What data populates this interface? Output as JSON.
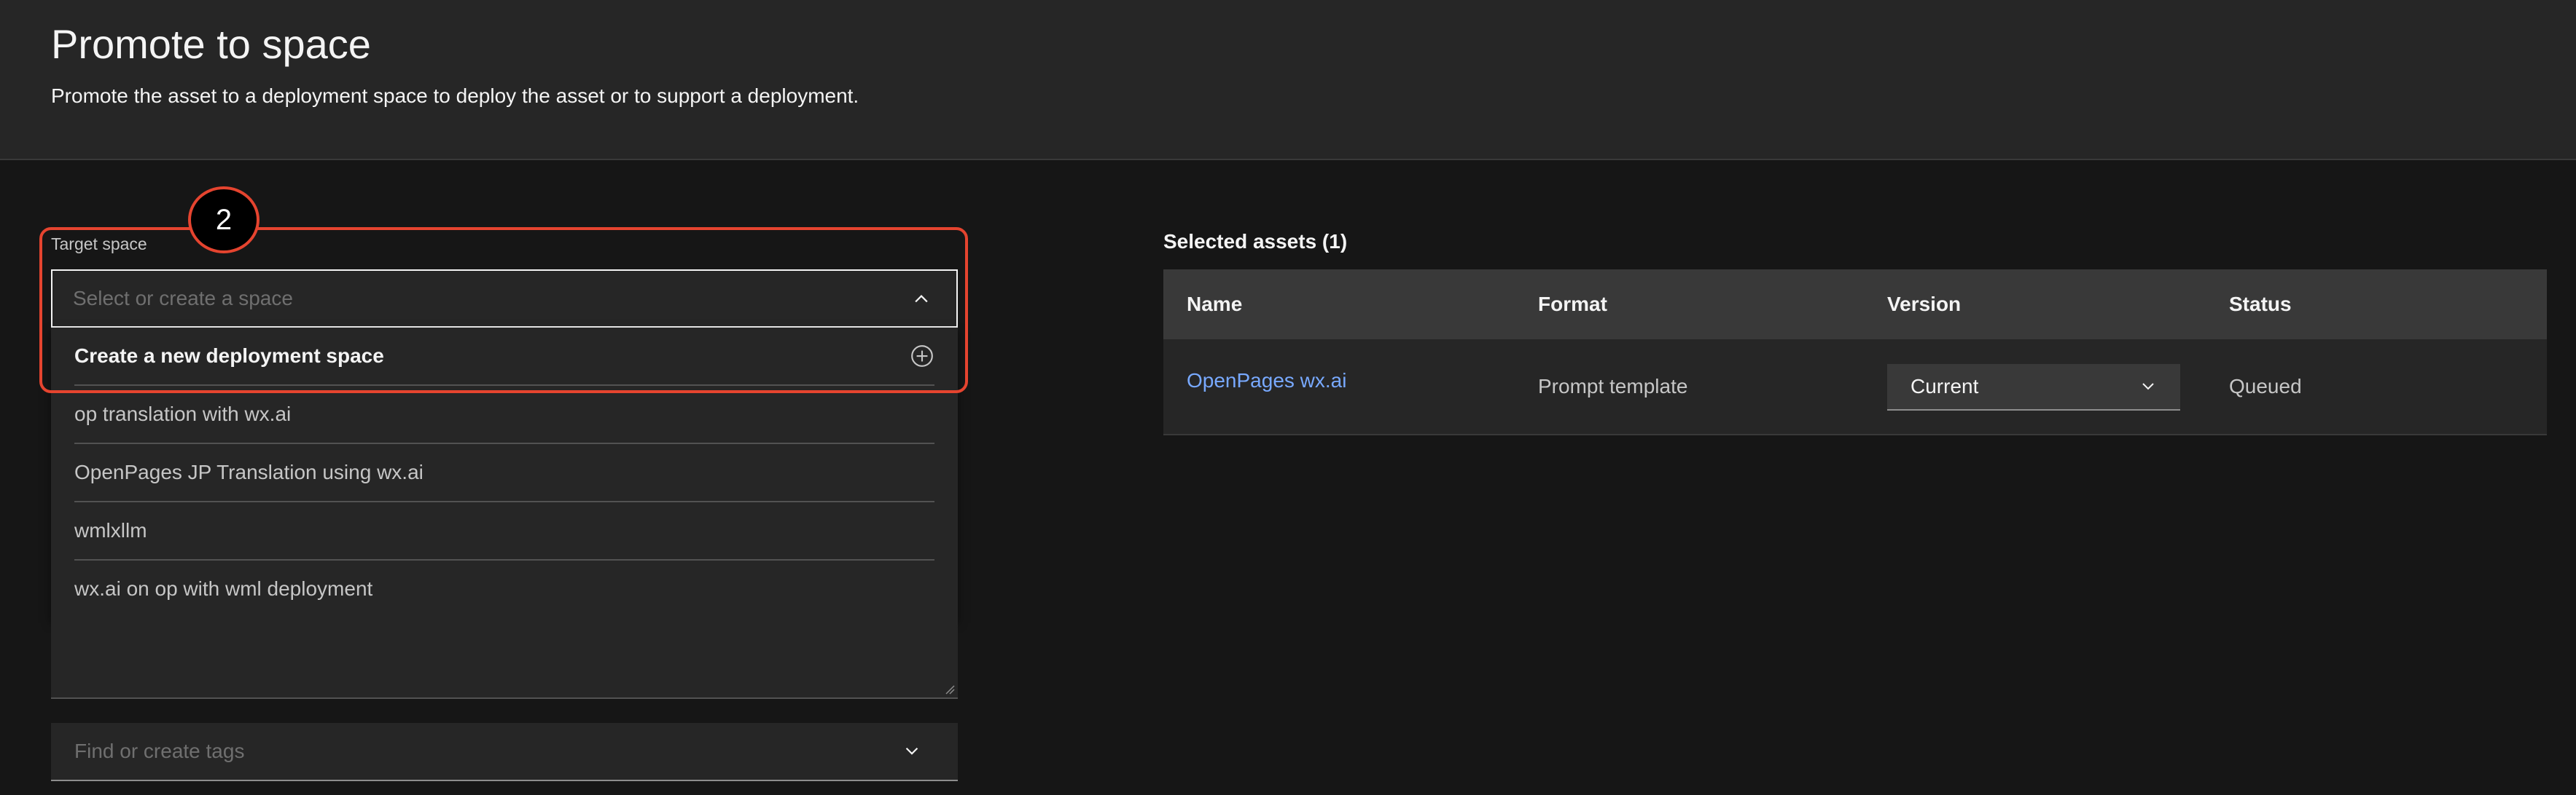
{
  "header": {
    "title": "Promote to space",
    "subtitle": "Promote the asset to a deployment space to deploy the asset or to support a deployment."
  },
  "target_space": {
    "label": "Target space",
    "placeholder": "Select or create a space",
    "create_option": "Create a new deployment space",
    "options": [
      "op translation with wx.ai",
      "OpenPages JP Translation using wx.ai",
      "wmlxllm",
      "wx.ai on op with wml deployment"
    ]
  },
  "tags": {
    "placeholder": "Find or create tags"
  },
  "annotation": {
    "step": "2"
  },
  "selected_assets": {
    "title": "Selected assets (1)",
    "columns": [
      "Name",
      "Format",
      "Version",
      "Status"
    ],
    "rows": [
      {
        "name": "OpenPages wx.ai",
        "format": "Prompt template",
        "version": "Current",
        "status": "Queued"
      }
    ]
  },
  "colors": {
    "background": "#161616",
    "header": "#262626",
    "link": "#78a9ff",
    "annotation": "#e5442f"
  },
  "icons": [
    "chevron-up-icon",
    "add-circle-icon",
    "chevron-down-icon",
    "resize-grip-icon"
  ]
}
